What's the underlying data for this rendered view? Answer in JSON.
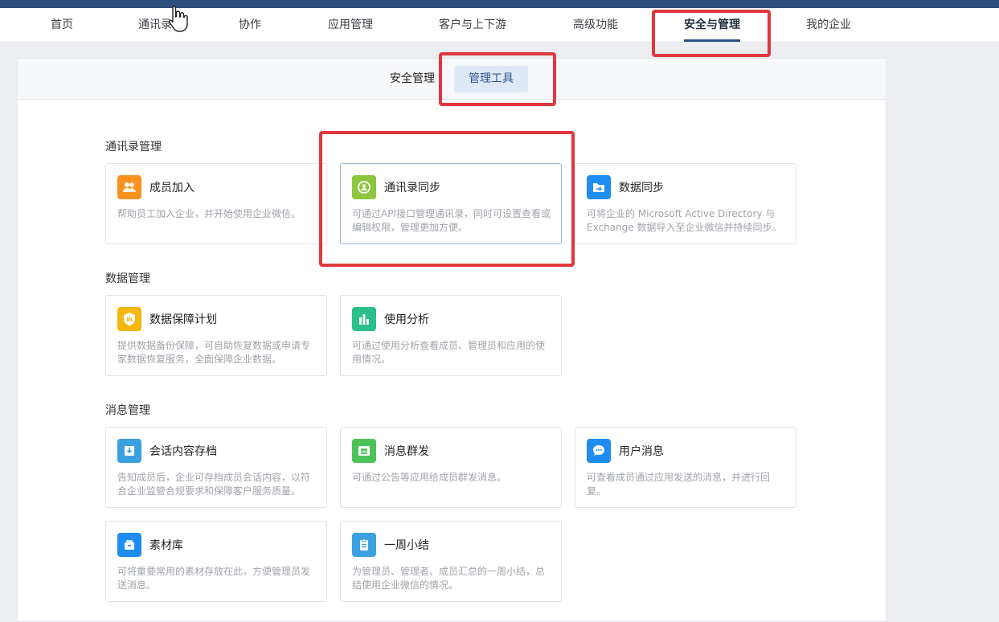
{
  "nav": {
    "items": [
      {
        "label": "首页"
      },
      {
        "label": "通讯录"
      },
      {
        "label": "协作"
      },
      {
        "label": "应用管理"
      },
      {
        "label": "客户与上下游"
      },
      {
        "label": "高级功能"
      },
      {
        "label": "安全与管理"
      },
      {
        "label": "我的企业"
      }
    ],
    "active": "安全与管理"
  },
  "subtabs": {
    "items": [
      {
        "label": "安全管理"
      },
      {
        "label": "管理工具"
      }
    ],
    "active": "管理工具"
  },
  "sections": [
    {
      "title": "通讯录管理",
      "cards": [
        {
          "title": "成员加入",
          "desc": "帮助员工加入企业，并开始使用企业微信。",
          "icon": "members-icon",
          "color": "#f7921e"
        },
        {
          "title": "通讯录同步",
          "desc": "可通过API接口管理通讯录，同时可设置查看或编辑权限，管理更加方便。",
          "icon": "sync-user-icon",
          "color": "#8dc63f"
        },
        {
          "title": "数据同步",
          "desc": "可将企业的 Microsoft Active Directory 与 Exchange 数据导入至企业微信并持续同步。",
          "icon": "folder-sync-icon",
          "color": "#1e8cf0"
        }
      ]
    },
    {
      "title": "数据管理",
      "cards": [
        {
          "title": "数据保障计划",
          "desc": "提供数据备份保障，可自助恢复数据或申请专家数据恢复服务，全面保障企业数据。",
          "icon": "shield-icon",
          "color": "#f5b70f"
        },
        {
          "title": "使用分析",
          "desc": "可通过使用分析查看成员、管理员和应用的使用情况。",
          "icon": "bar-chart-icon",
          "color": "#2bbf8a"
        }
      ]
    },
    {
      "title": "消息管理",
      "cards": [
        {
          "title": "会话内容存档",
          "desc": "告知成员后，企业可存档成员会话内容，以符合企业监管合规要求和保障客户服务质量。",
          "icon": "archive-icon",
          "color": "#3aa0e0"
        },
        {
          "title": "消息群发",
          "desc": "可通过公告等应用给成员群发消息。",
          "icon": "broadcast-icon",
          "color": "#4cc35a"
        },
        {
          "title": "用户消息",
          "desc": "可查看成员通过应用发送的消息，并进行回复。",
          "icon": "chat-bubble-icon",
          "color": "#1e8cf0"
        },
        {
          "title": "素材库",
          "desc": "可将重要常用的素材存放在此，方便管理员发送消息。",
          "icon": "material-box-icon",
          "color": "#1e8cf0"
        },
        {
          "title": "一周小结",
          "desc": "为管理员、管理者、成员汇总的一周小结，总结使用企业微信的情况。",
          "icon": "clipboard-icon",
          "color": "#3aa0e0"
        }
      ]
    }
  ]
}
